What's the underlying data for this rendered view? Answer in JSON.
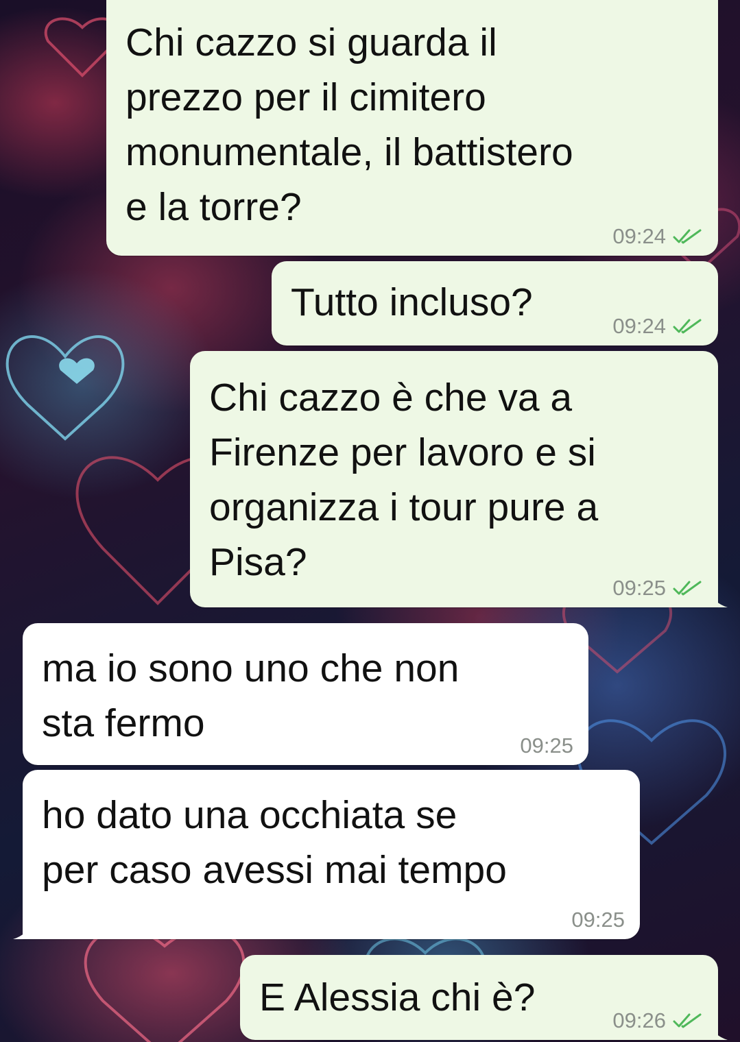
{
  "chat": {
    "messages": [
      {
        "direction": "outgoing",
        "text": "Chi cazzo si guarda il\nprezzo per il cimitero\nmonumentale, il battistero\ne la torre?",
        "time": "09:24",
        "status": "read"
      },
      {
        "direction": "outgoing",
        "text": "Tutto incluso?",
        "time": "09:24",
        "status": "read"
      },
      {
        "direction": "outgoing",
        "text": "Chi cazzo è che va a\nFirenze per lavoro e si\norganizza i tour pure a\nPisa?",
        "time": "09:25",
        "status": "read"
      },
      {
        "direction": "incoming",
        "text": "ma io sono uno che non\nsta fermo",
        "time": "09:25"
      },
      {
        "direction": "incoming",
        "text": "ho dato una occhiata se\nper caso avessi mai tempo",
        "time": "09:25"
      },
      {
        "direction": "outgoing",
        "text": "E Alessia chi è?",
        "time": "09:26",
        "status": "read"
      }
    ]
  },
  "colors": {
    "outgoing_bubble": "#eef8e5",
    "incoming_bubble": "#ffffff",
    "read_ticks": "#4fb85a",
    "time_text": "#8a8f8a"
  },
  "icons": {
    "read_status": "double-check-icon",
    "background": "hearts-wallpaper"
  }
}
